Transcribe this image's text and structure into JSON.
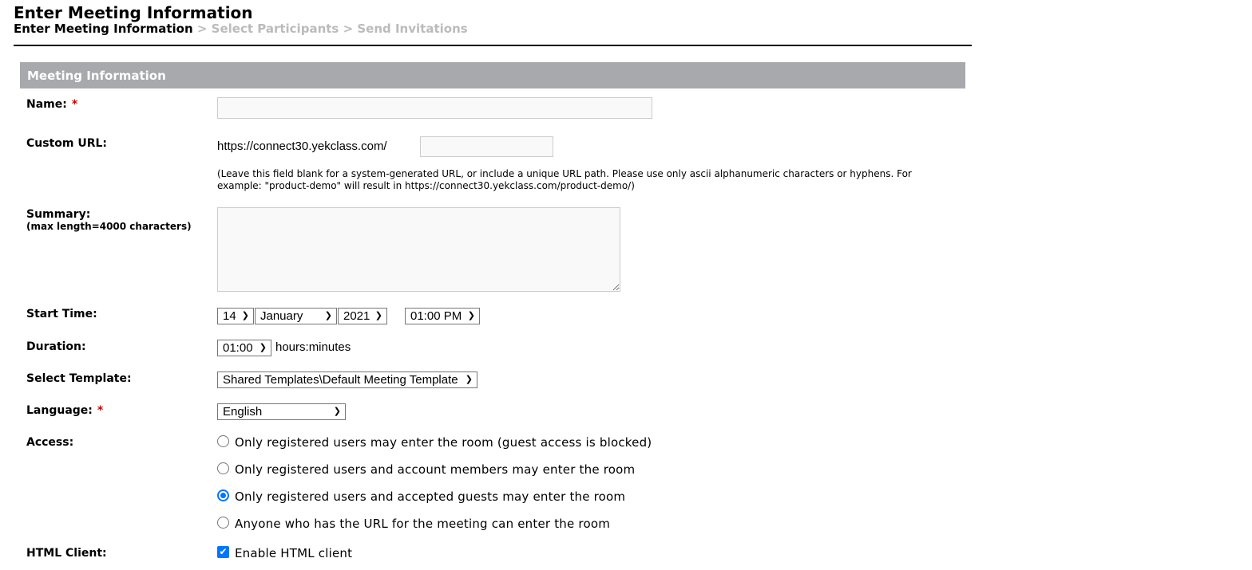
{
  "page": {
    "title": "Enter Meeting Information"
  },
  "breadcrumb": {
    "step1": "Enter Meeting Information",
    "sep": " > ",
    "step2": "Select Participants",
    "step3": "Send Invitations"
  },
  "section": {
    "title": "Meeting Information"
  },
  "form": {
    "name": {
      "label": "Name:",
      "required": "*",
      "value": ""
    },
    "custom_url": {
      "label": "Custom URL:",
      "prefix": "https://connect30.yekclass.com/",
      "value": "",
      "note": "(Leave this field blank for a system-generated URL, or include a unique URL path. Please use only ascii alphanumeric characters or hyphens. For example: \"product-demo\" will result in https://connect30.yekclass.com/product-demo/)"
    },
    "summary": {
      "label": "Summary:",
      "sublabel": "(max length=4000 characters)",
      "value": ""
    },
    "start_time": {
      "label": "Start Time:",
      "day": "14",
      "month": "January",
      "year": "2021",
      "time": "01:00 PM"
    },
    "duration": {
      "label": "Duration:",
      "value": "01:00",
      "unit": "hours:minutes"
    },
    "template": {
      "label": "Select Template:",
      "value": "Shared Templates\\Default Meeting Template"
    },
    "language": {
      "label": "Language:",
      "required": "*",
      "value": "English"
    },
    "access": {
      "label": "Access:",
      "selected_index": 2,
      "options": [
        "Only registered users may enter the room (guest access is blocked)",
        "Only registered users and account members may enter the room",
        "Only registered users and accepted guests may enter the room",
        "Anyone who has the URL for the meeting can enter the room"
      ]
    },
    "html_client": {
      "label": "HTML Client:",
      "option": "Enable HTML client",
      "checked": true
    }
  },
  "colors": {
    "section_bar": "#a7a9ac",
    "required": "#cc0000",
    "accent": "#0075ff",
    "inactive_step": "#bbbbbb"
  }
}
